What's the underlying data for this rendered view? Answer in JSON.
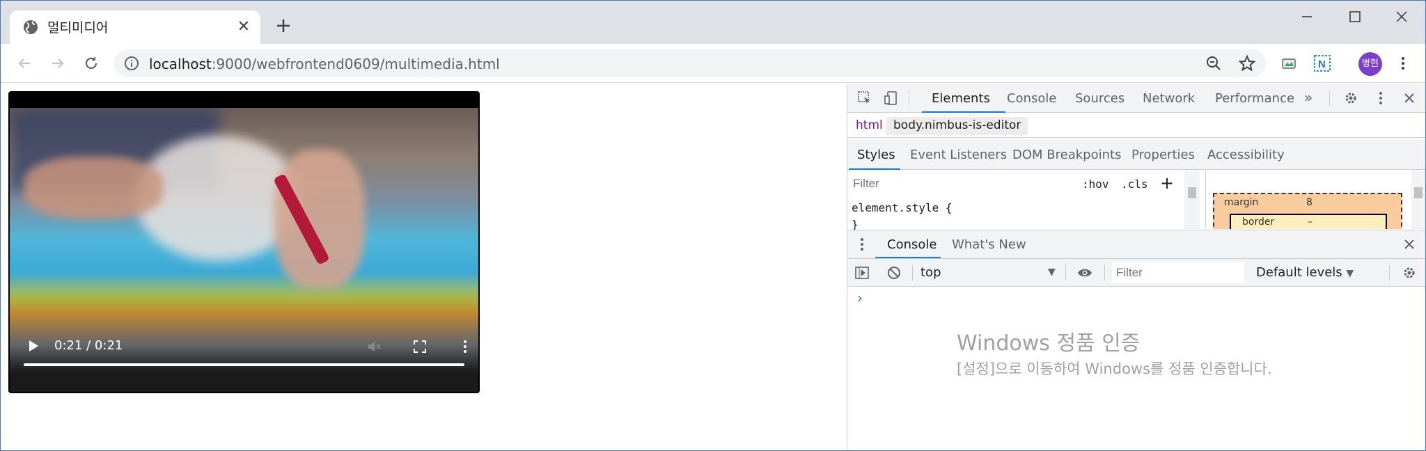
{
  "browser": {
    "tab_title": "멀티미디어",
    "url_host": "localhost",
    "url_path": ":9000/webfrontend0609/multimedia.html",
    "profile_initials": "병현"
  },
  "video": {
    "time": "0:21 / 0:21",
    "progress": 1.0
  },
  "devtools": {
    "tabs": [
      "Elements",
      "Console",
      "Sources",
      "Network",
      "Performance"
    ],
    "more": "»",
    "breadcrumbs": [
      "html",
      "body.nimbus-is-editor"
    ],
    "subtabs": [
      "Styles",
      "Event Listeners",
      "DOM Breakpoints",
      "Properties",
      "Accessibility"
    ],
    "styles": {
      "filter_placeholder": "Filter",
      "hov": ":hov",
      "cls": ".cls",
      "plus": "+",
      "rule_line1": "element.style {",
      "rule_line2": "}"
    },
    "box_model": {
      "margin_label": "margin",
      "margin_value": "8",
      "border_label": "border",
      "border_value": "–"
    },
    "drawer_tabs": [
      "Console",
      "What's New"
    ],
    "console": {
      "context": "top",
      "filter_placeholder": "Filter",
      "levels": "Default levels",
      "prompt": "›"
    }
  },
  "watermark": {
    "line1": "Windows 정품 인증",
    "line2": "[설정]으로 이동하여 Windows를 정품 인증합니다."
  }
}
